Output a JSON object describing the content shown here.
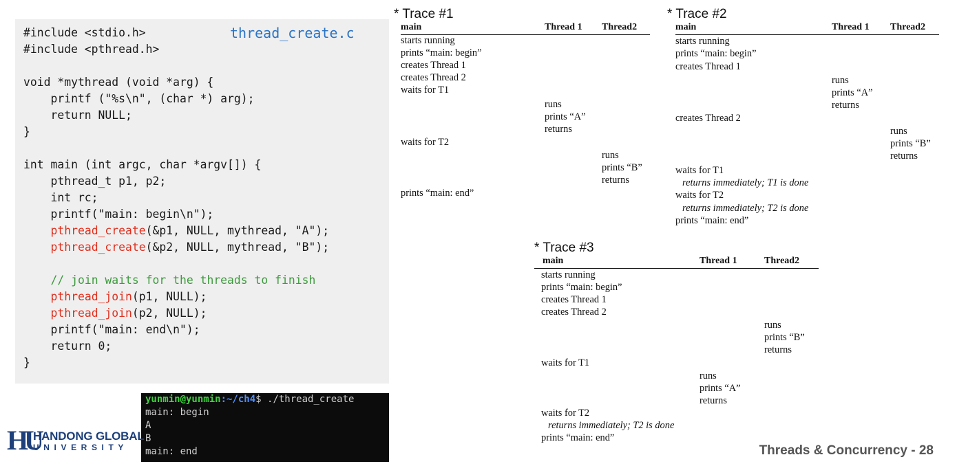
{
  "code": {
    "title": "thread_create.c",
    "lines": [
      "#include <stdio.h>",
      "#include <pthread.h>",
      "",
      "void *mythread (void *arg) {",
      "    printf (\"%s\\n\", (char *) arg);",
      "    return NULL;",
      "}",
      "",
      "int main (int argc, char *argv[]) {",
      "    pthread_t p1, p2;",
      "    int rc;",
      "    printf(\"main: begin\\n\");",
      "    pthread_create(&p1, NULL, mythread, \"A\");",
      "    pthread_create(&p2, NULL, mythread, \"B\");",
      "",
      "    // join waits for the threads to finish",
      "    pthread_join(p1, NULL);",
      "    pthread_join(p2, NULL);",
      "    printf(\"main: end\\n\");",
      "    return 0;",
      "}"
    ],
    "pc1_fn": "pthread_create",
    "pc1_rest": "(&p1, NULL, mythread, \"A\");",
    "pc2_fn": "pthread_create",
    "pc2_rest": "(&p2, NULL, mythread, \"B\");",
    "comment": "// join waits for the threads to finish",
    "pj1_fn": "pthread_join",
    "pj1_rest": "(p1, NULL);",
    "pj2_fn": "pthread_join",
    "pj2_rest": "(p2, NULL);"
  },
  "terminal": {
    "user": "yunmin@yunmin",
    "path": ":~/ch4",
    "prompt": "$ ./thread_create",
    "output": [
      "main: begin",
      "A",
      "B",
      "main: end"
    ]
  },
  "logo": {
    "mark": "HU",
    "name": "HANDONG GLOBAL",
    "sub": "UNIVERSITY"
  },
  "traces": {
    "t1": {
      "title": "* Trace #1",
      "headers": [
        "main",
        "Thread 1",
        "Thread2"
      ],
      "main": [
        "starts running",
        "prints “main: begin”",
        "creates Thread 1",
        "creates Thread 2",
        "waits for T1",
        "waits for T2",
        "prints “main: end”"
      ],
      "thread1": [
        "runs",
        "prints “A”",
        "returns"
      ],
      "thread2": [
        "runs",
        "prints “B”",
        "returns"
      ]
    },
    "t2": {
      "title": "* Trace #2",
      "headers": [
        "main",
        "Thread 1",
        "Thread2"
      ],
      "main": [
        "starts running",
        "prints “main: begin”",
        "creates Thread 1",
        "creates Thread 2",
        "waits for T1",
        "returns immediately; T1 is done",
        "waits for T2",
        "returns immediately; T2 is done",
        "prints “main: end”"
      ],
      "thread1": [
        "runs",
        "prints “A”",
        "returns"
      ],
      "thread2": [
        "runs",
        "prints “B”",
        "returns"
      ]
    },
    "t3": {
      "title": "* Trace #3",
      "headers": [
        "main",
        "Thread 1",
        "Thread2"
      ],
      "main": [
        "starts running",
        "prints “main: begin”",
        "creates Thread 1",
        "creates Thread 2",
        "waits for T1",
        "waits for T2",
        "returns immediately; T2 is done",
        "prints “main: end”"
      ],
      "thread1": [
        "runs",
        "prints “A”",
        "returns"
      ],
      "thread2": [
        "runs",
        "prints “B”",
        "returns"
      ]
    }
  },
  "footer": "Threads & Concurrency - 28"
}
